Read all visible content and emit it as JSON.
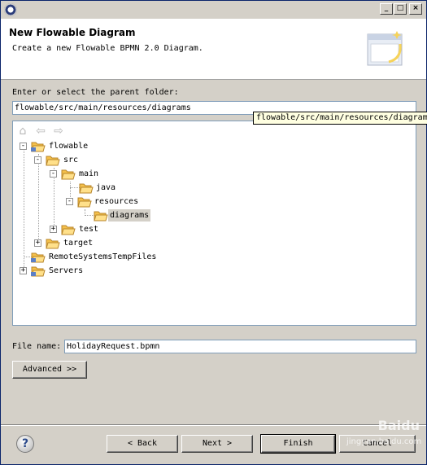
{
  "window": {
    "title": "",
    "controls": {
      "minimize": "_",
      "maximize": "□",
      "close": "×"
    }
  },
  "banner": {
    "title": "New Flowable Diagram",
    "description": "Create a new Flowable BPMN 2.0 Diagram."
  },
  "parent_folder": {
    "label": "Enter or select the parent folder:",
    "value": "flowable/src/main/resources/diagrams",
    "tooltip": "flowable/src/main/resources/diagrams"
  },
  "tree_toolbar": {
    "home_icon": "home-icon",
    "back_icon": "back-arrow-icon",
    "forward_icon": "forward-arrow-icon"
  },
  "tree": {
    "nodes": [
      {
        "label": "flowable",
        "expander": "-",
        "open": true,
        "project": true
      },
      {
        "label": "src",
        "expander": "-",
        "open": true
      },
      {
        "label": "main",
        "expander": "-",
        "open": true
      },
      {
        "label": "java",
        "expander": "",
        "open": false
      },
      {
        "label": "resources",
        "expander": "-",
        "open": true
      },
      {
        "label": "diagrams",
        "expander": "",
        "open": false,
        "selected": true
      },
      {
        "label": "test",
        "expander": "+",
        "open": false
      },
      {
        "label": "target",
        "expander": "+",
        "open": false
      },
      {
        "label": "RemoteSystemsTempFiles",
        "expander": "",
        "open": false,
        "project": true
      },
      {
        "label": "Servers",
        "expander": "+",
        "open": false,
        "project": true
      }
    ]
  },
  "file_name": {
    "label": "File name:",
    "value": "HolidayRequest.bpmn"
  },
  "advanced_button": "Advanced >>",
  "footer": {
    "help": "?",
    "back": "< Back",
    "next": "Next >",
    "finish": "Finish",
    "cancel": "Cancel"
  },
  "watermark": {
    "main": "Baidu",
    "sub": "jingyan.baidu.com"
  },
  "colors": {
    "dialog_bg": "#d4d0c8",
    "banner_bg": "#ffffff",
    "field_border": "#7f9db9",
    "tooltip_bg": "#ffffe1",
    "folder": "#f5c04a"
  }
}
